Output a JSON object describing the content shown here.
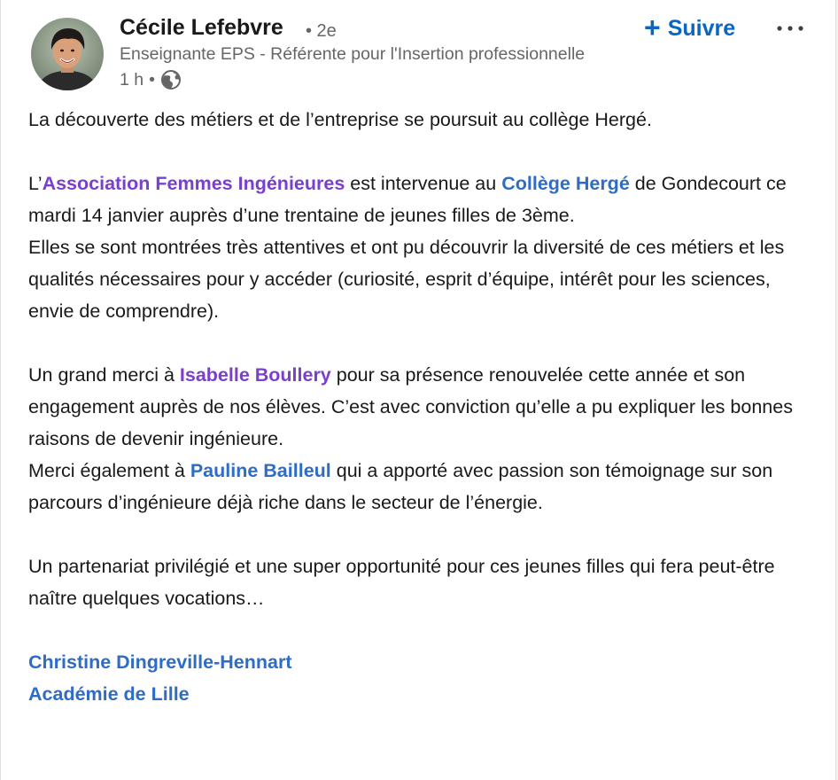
{
  "author": {
    "name": "Cécile Lefebvre",
    "degree": "• 2e",
    "headline": "Enseignante EPS - Référente pour l'Insertion professionnelle",
    "time": "1 h",
    "dot": "•",
    "visibility_icon": "globe-icon"
  },
  "actions": {
    "follow_plus": "+",
    "follow_label": "Suivre",
    "more_icon": "more-horizontal-icon"
  },
  "post": {
    "intro": "La découverte des métiers et de l’entreprise se poursuit au collège Hergé.",
    "p2_prefix": "L’",
    "p2_mention1": "Association Femmes Ingénieures",
    "p2_mid": " est intervenue au ",
    "p2_mention2": "Collège Hergé",
    "p2_rest": " de Gondecourt ce mardi 14 janvier auprès d’une trentaine de jeunes filles de 3ème.",
    "p3": "Elles se sont montrées très attentives et ont pu découvrir la diversité de ces métiers et les qualités nécessaires pour y accéder (curiosité, esprit d’équipe, intérêt pour les sciences, envie de comprendre).",
    "p4_prefix": "Un grand merci à ",
    "p4_mention": "Isabelle Boullery",
    "p4_rest": " pour sa présence renouvelée cette année et son engagement auprès de nos élèves. C’est avec conviction qu’elle a pu expliquer les bonnes raisons de devenir ingénieure.",
    "p5_prefix": "Merci également à ",
    "p5_mention": "Pauline Bailleul",
    "p5_rest": " qui a apporté avec passion son témoignage sur son parcours d’ingénieure déjà riche dans le secteur de l’énergie.",
    "p6": "Un partenariat privilégié et une super opportunité pour ces jeunes filles qui fera peut-être naître quelques vocations…",
    "mention_last1": "Christine Dingreville-Hennart",
    "mention_last2": "Académie de Lille"
  },
  "colors": {
    "link_blue": "#2e6cc6",
    "mention_purple": "#7a3fcd",
    "follow_blue": "#0a66c2",
    "text": "#191919",
    "muted": "#666666"
  }
}
